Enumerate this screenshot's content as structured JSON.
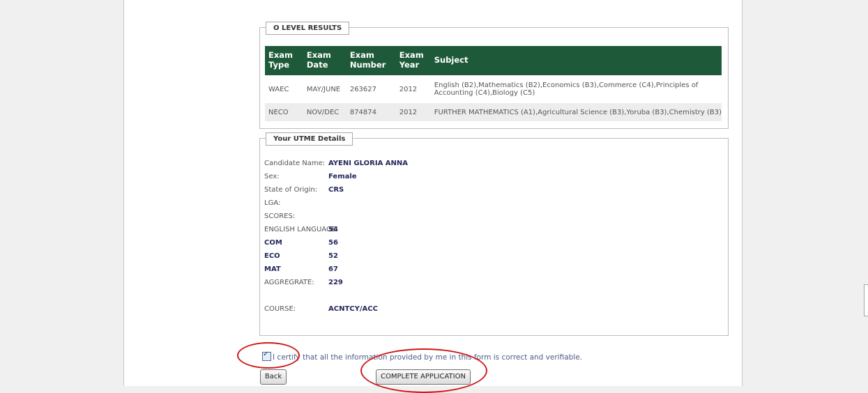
{
  "olevel": {
    "legend": "O LEVEL RESULTS",
    "columns": [
      "Exam Type",
      "Exam Date",
      "Exam Number",
      "Exam Year",
      "Subject"
    ],
    "rows": [
      {
        "type": "WAEC",
        "date": "MAY/JUNE",
        "number": "263627",
        "year": "2012",
        "subject": "English (B2),Mathematics (B2),Economics (B3),Commerce (C4),Principles of Accounting (C4),Biology (C5)"
      },
      {
        "type": "NECO",
        "date": "NOV/DEC",
        "number": "874874",
        "year": "2012",
        "subject": "FURTHER MATHEMATICS (A1),Agricultural Science (B3),Yoruba (B3),Chemistry (B3)"
      }
    ]
  },
  "utme": {
    "legend": "Your UTME Details",
    "candidate_label": "Candidate Name:",
    "candidate_value": "AYENI GLORIA ANNA",
    "sex_label": "Sex:",
    "sex_value": "Female",
    "state_label": "State of Origin:",
    "state_value": "CRS",
    "lga_label": "LGA:",
    "scores_label": "SCORES:",
    "scores": [
      {
        "subject": "ENGLISH LANGUAGE",
        "score": "54"
      },
      {
        "subject": "COM",
        "score": "56"
      },
      {
        "subject": "ECO",
        "score": "52"
      },
      {
        "subject": "MAT",
        "score": "67"
      }
    ],
    "aggregate_label": "AGGREGRATE:",
    "aggregate_value": "229",
    "course_label": "COURSE:",
    "course_value": "ACNTCY/ACC"
  },
  "certify_text": "I certify that all the information provided by me in this form is correct and verifiable.",
  "certify_checked": true,
  "back_label": "Back",
  "complete_label": "COMPLETE APPLICATION",
  "annotation_color": "#d01818"
}
